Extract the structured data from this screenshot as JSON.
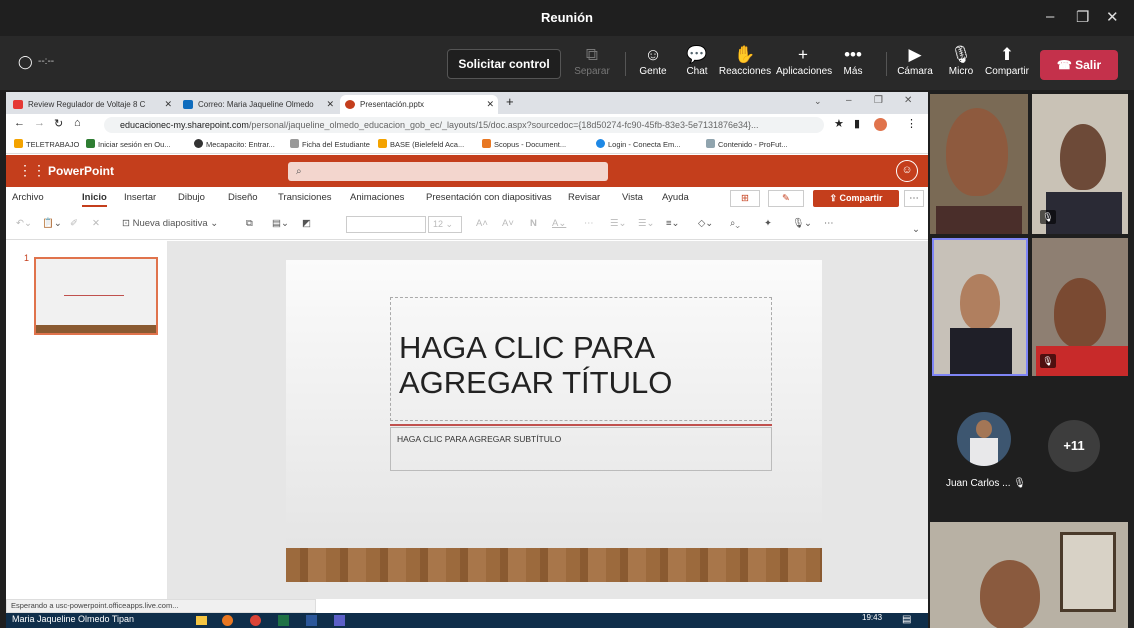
{
  "window": {
    "title": "Reunión",
    "minimize": "–",
    "maximize": "❐",
    "close": "✕"
  },
  "meeting": {
    "timer": "--:--",
    "request_control": "Solicitar control",
    "buttons": [
      {
        "label": "Separar",
        "icon": "⧉"
      },
      {
        "label": "Gente",
        "icon": "☺"
      },
      {
        "label": "Chat",
        "icon": "💬"
      },
      {
        "label": "Reacciones",
        "icon": "✋"
      },
      {
        "label": "Aplicaciones",
        "icon": "+"
      },
      {
        "label": "Más",
        "icon": "•••"
      },
      {
        "label": "Cámara",
        "icon": "▶"
      },
      {
        "label": "Micro",
        "icon": "🎙"
      },
      {
        "label": "Compartir",
        "icon": "⬆"
      }
    ],
    "leave": "Salir",
    "leave_color": "#c4314b"
  },
  "browser": {
    "tabs": [
      {
        "label": "Review Regulador de Voltaje 8 C",
        "color": "#e53935"
      },
      {
        "label": "Correo: Maria Jaqueline Olmedo",
        "color": "#0f6cbd"
      },
      {
        "label": "Presentación.pptx",
        "color": "#c43e1c"
      }
    ],
    "new_tab": "+",
    "url_domain": "educacionec-my.sharepoint.com",
    "url_path": "/personal/jaqueline_olmedo_educacion_gob_ec/_layouts/15/doc.aspx?sourcedoc={18d50274-fc90-45fb-83e3-5e7131876e34}...",
    "bookmarks": [
      "TELETRABAJO",
      "Iniciar sesión en Ou...",
      "Mecapacito: Entrar...",
      "Ficha del Estudiante",
      "BASE (Bielefeld Aca...",
      "Scopus - Document...",
      "Login - Conecta Em...",
      "Contenido - ProFut..."
    ]
  },
  "ppt": {
    "app": "PowerPoint",
    "search_icon": "⌕",
    "menu": [
      "Archivo",
      "Inicio",
      "Insertar",
      "Dibujo",
      "Diseño",
      "Transiciones",
      "Animaciones",
      "Presentación con diapositivas",
      "Revisar",
      "Vista",
      "Ayuda"
    ],
    "active_menu": "Inicio",
    "share": "Compartir",
    "new_slide": "Nueva diapositiva",
    "font_size": "12",
    "bold": "N",
    "slide_number": "1",
    "title": "HAGA CLIC PARA AGREGAR TÍTULO",
    "subtitle": "HAGA CLIC PARA AGREGAR SUBTÍTULO",
    "status": "Esperando a usc-powerpoint.officeapps.live.com...",
    "brand_color": "#c43e1c"
  },
  "taskbar": {
    "user": "Maria Jaqueline Olmedo Tipan",
    "time": "19:43"
  },
  "participants": {
    "named": "Juan Carlos ...",
    "more": "+11"
  }
}
